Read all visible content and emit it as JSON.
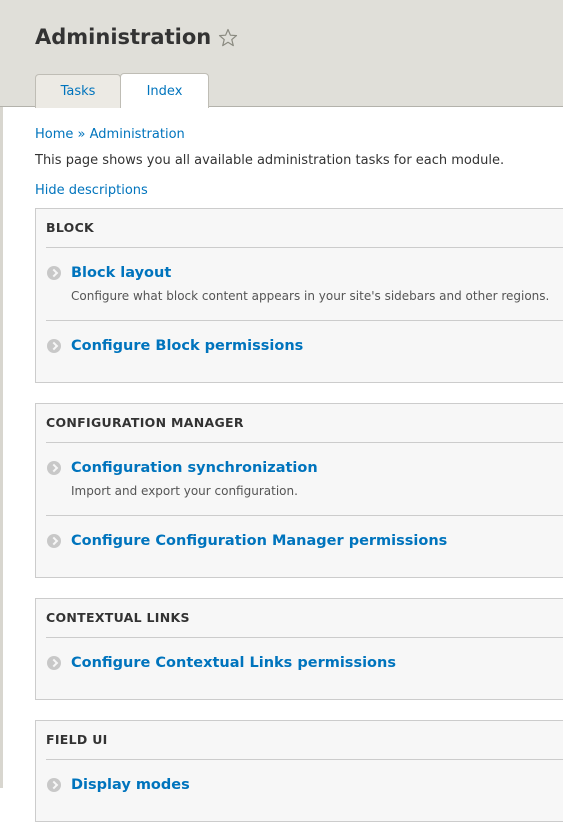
{
  "header": {
    "title": "Administration",
    "shortcut_icon": "star-outline-icon"
  },
  "tabs": [
    {
      "label": "Tasks",
      "active": false
    },
    {
      "label": "Index",
      "active": true
    }
  ],
  "breadcrumb": {
    "items": [
      "Home",
      "Administration"
    ],
    "separator": "»"
  },
  "intro": "This page shows you all available administration tasks for each module.",
  "toggle_descriptions": "Hide descriptions",
  "colors": {
    "link": "#0074bd",
    "header_bg": "#e0dfd9",
    "panel_bg": "#f7f7f7"
  },
  "panels": [
    {
      "title": "BLOCK",
      "items": [
        {
          "label": "Block layout",
          "description": "Configure what block content appears in your site's sidebars and other regions."
        },
        {
          "label": "Configure Block permissions",
          "description": ""
        }
      ]
    },
    {
      "title": "CONFIGURATION MANAGER",
      "items": [
        {
          "label": "Configuration synchronization",
          "description": "Import and export your configuration."
        },
        {
          "label": "Configure Configuration Manager permissions",
          "description": ""
        }
      ]
    },
    {
      "title": "CONTEXTUAL LINKS",
      "items": [
        {
          "label": "Configure Contextual Links permissions",
          "description": ""
        }
      ]
    },
    {
      "title": "FIELD UI",
      "items": [
        {
          "label": "Display modes",
          "description": ""
        }
      ]
    }
  ]
}
